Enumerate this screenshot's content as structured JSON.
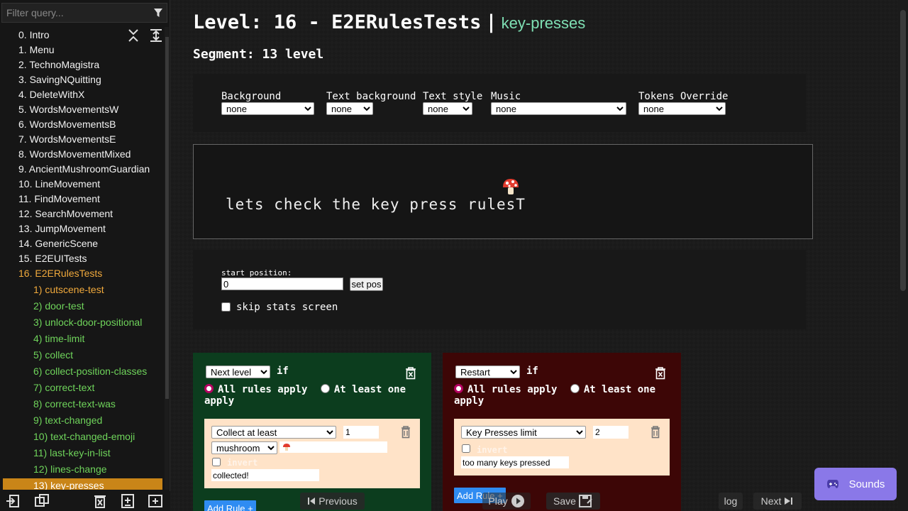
{
  "sidebar": {
    "filter_placeholder": "Filter query...",
    "levels": [
      "0. Intro",
      "1. Menu",
      "2. TechnoMagistra",
      "3. SavingNQuitting",
      "4. DeleteWithX",
      "5. WordsMovementsW",
      "6. WordsMovementsB",
      "7. WordsMovementsE",
      "8. WordsMovementMixed",
      "9. AncientMushroomGuardian",
      "10. LineMovement",
      "11. FindMovement",
      "12. SearchMovement",
      "13. JumpMovement",
      "14. GenericScene",
      "15. E2EUITests",
      "16. E2ERulesTests"
    ],
    "segments": [
      "1) cutscene-test",
      "2) door-test",
      "3) unlock-door-positional",
      "4) time-limit",
      "5) collect",
      "6) collect-position-classes",
      "7) correct-text",
      "8) correct-text-was",
      "9) text-changed",
      "10) text-changed-emoji",
      "11) last-key-in-list",
      "12) lines-change",
      "13) key-presses"
    ]
  },
  "header": {
    "level_title": "Level: 16 - E2ERulesTests",
    "separator": "|",
    "segment_name": "key-presses",
    "segment_line": "Segment: 13 level"
  },
  "style_panel": {
    "background_label": "Background",
    "background_value": "none",
    "text_background_label": "Text background",
    "text_background_value": "none",
    "text_style_label": "Text style",
    "text_style_value": "none",
    "music_label": "Music",
    "music_value": "none",
    "tokens_override_label": "Tokens Override",
    "tokens_override_value": "none"
  },
  "preview": {
    "text": "lets check the key press rules",
    "cursor": "T",
    "token_icon": "mushroom-icon"
  },
  "position_panel": {
    "start_label": "start position:",
    "start_value": "0",
    "set_pos_label": "set pos",
    "skip_label": "skip stats screen"
  },
  "rules": [
    {
      "action": "Next level",
      "if_label": "if",
      "all_label": "All rules apply",
      "one_label": "At least one apply",
      "condition": "Collect at least",
      "count": "1",
      "token": "mushroom",
      "invert_label": "invert",
      "message": "collected!",
      "add_label": "Add Rule +",
      "color": "#0c3d1e"
    },
    {
      "action": "Restart",
      "if_label": "if",
      "all_label": "All rules apply",
      "one_label": "At least one apply",
      "condition": "Key Presses limit",
      "count": "2",
      "invert_label": "invert",
      "message": "too many keys pressed",
      "add_label": "Add Rule +",
      "color": "#3d0606"
    }
  ],
  "bottom_nav": {
    "previous_label": "Previous",
    "play_label": "Play",
    "save_label": "Save",
    "log_label": "log",
    "next_label": "Next",
    "sounds_label": "Sounds"
  },
  "colors": {
    "active_level": "#f0a93c",
    "segment_green": "#6fd45b",
    "selected_segment_bg": "#c98518",
    "segment_name": "#7fe0b4",
    "sounds_button": "#8a78e8",
    "add_rule_button": "#2f8cf2"
  }
}
